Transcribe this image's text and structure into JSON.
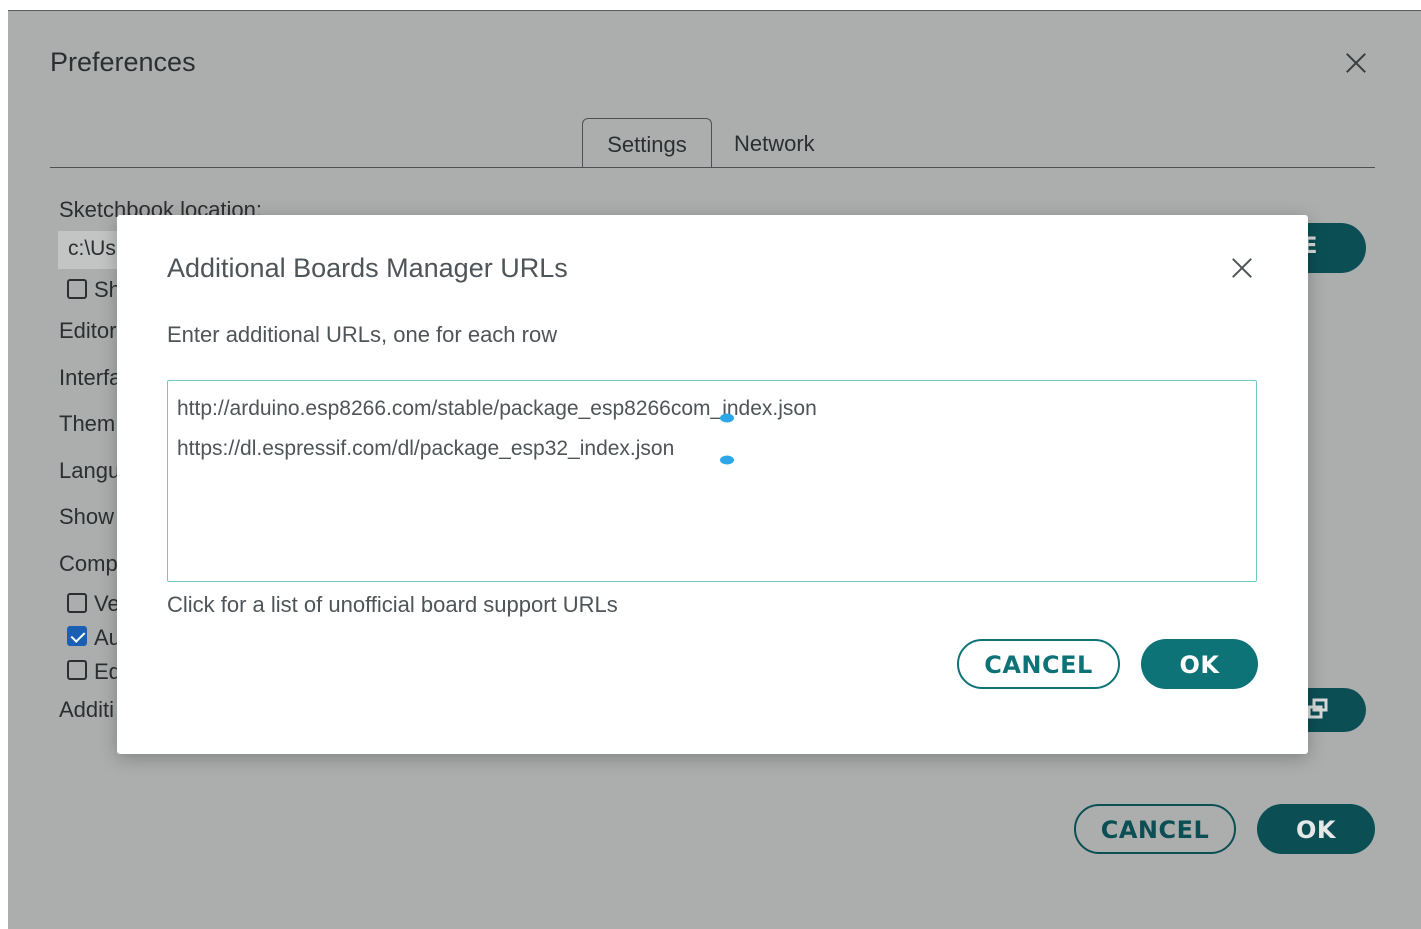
{
  "preferences": {
    "title": "Preferences",
    "tabs": [
      {
        "label": "Settings",
        "active": true
      },
      {
        "label": "Network",
        "active": false
      }
    ],
    "sketchbook_label": "Sketchbook location:",
    "sketchbook_value": "c:\\Us",
    "browse_label": "SE",
    "partial_labels": {
      "show": "Sh",
      "editor": "Editor",
      "interface": "Interfa",
      "theme": "Them",
      "language": "Langu",
      "show2": "Show",
      "compiler": "Comp",
      "verify": "Ve",
      "auto": "Au",
      "editor_quick": "Ed",
      "additional": "Additi"
    },
    "checkboxes": {
      "show": false,
      "verify": false,
      "auto": true,
      "editor_quick": false
    },
    "cancel_label": "CANCEL",
    "ok_label": "OK"
  },
  "modal": {
    "title": "Additional Boards Manager URLs",
    "description": "Enter additional URLs, one for each row",
    "urls": [
      "http://arduino.esp8266.com/stable/package_esp8266com_index.json",
      "https://dl.espressif.com/dl/package_esp32_index.json"
    ],
    "link_text": "Click for a list of unofficial board support URLs",
    "cancel_label": "CANCEL",
    "ok_label": "OK"
  },
  "colors": {
    "overlay_bg": "#acaeae",
    "accent": "#0d7377",
    "accent_dim": "#0b4f55",
    "text": "#4e5457",
    "input_border": "#6fc9c4",
    "cursor_handle": "#2ba6e6"
  },
  "icons": {
    "prefs_close": "close-icon",
    "modal_close": "close-icon",
    "url_editor": "open-external-icon"
  }
}
